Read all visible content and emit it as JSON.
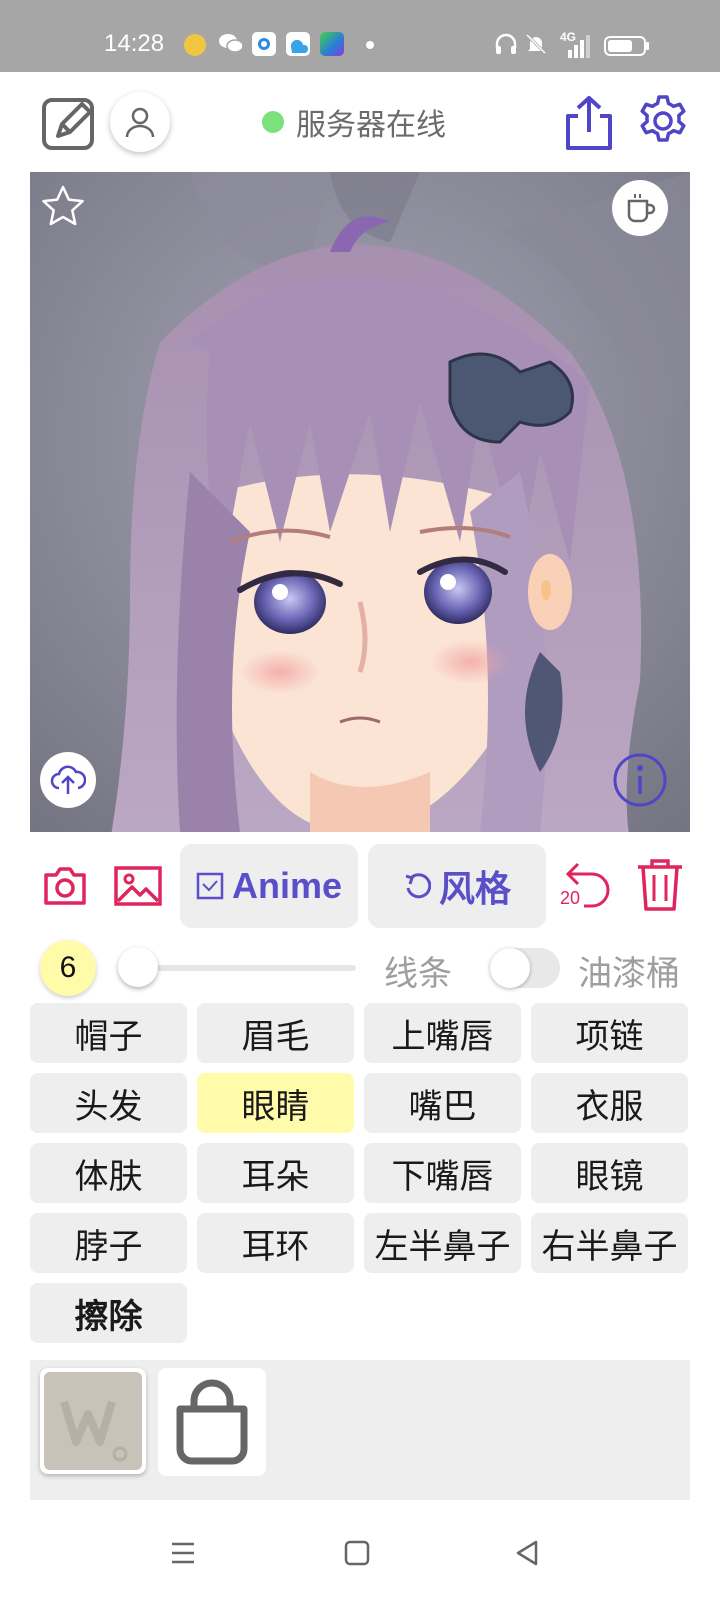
{
  "status_bar": {
    "time": "14:28",
    "network": "4G"
  },
  "top_bar": {
    "server_status": "服务器在线",
    "server_status_color": "#7be27b",
    "accent_color": "#4f45c6"
  },
  "toolbar": {
    "anime_label": "Anime",
    "style_label": "风格",
    "undo_count": "20",
    "danger_color": "#e0245e"
  },
  "brush": {
    "size": "6",
    "size_slider_level": 0.0,
    "line_label": "线条",
    "line_toggle_on": false,
    "bucket_label": "油漆桶"
  },
  "parts": [
    {
      "label": "帽子",
      "selected": false
    },
    {
      "label": "眉毛",
      "selected": false
    },
    {
      "label": "上嘴唇",
      "selected": false
    },
    {
      "label": "项链",
      "selected": false
    },
    {
      "label": "头发",
      "selected": false
    },
    {
      "label": "眼睛",
      "selected": true
    },
    {
      "label": "嘴巴",
      "selected": false
    },
    {
      "label": "衣服",
      "selected": false
    },
    {
      "label": "体肤",
      "selected": false
    },
    {
      "label": "耳朵",
      "selected": false
    },
    {
      "label": "下嘴唇",
      "selected": false
    },
    {
      "label": "眼镜",
      "selected": false
    },
    {
      "label": "脖子",
      "selected": false
    },
    {
      "label": "耳环",
      "selected": false
    },
    {
      "label": "左半鼻子",
      "selected": false
    },
    {
      "label": "右半鼻子",
      "selected": false
    },
    {
      "label": "擦除",
      "selected": false
    }
  ],
  "icons": {
    "edit": "edit-pen-icon",
    "user": "user-icon",
    "share": "share-icon",
    "settings": "gear-icon",
    "favorite": "star-icon",
    "coffee": "coffee-cup-icon",
    "upload": "cloud-upload-icon",
    "info": "info-icon",
    "camera": "camera-icon",
    "gallery": "image-icon",
    "undo": "undo-icon",
    "delete": "trash-icon",
    "bag": "bag-icon"
  }
}
